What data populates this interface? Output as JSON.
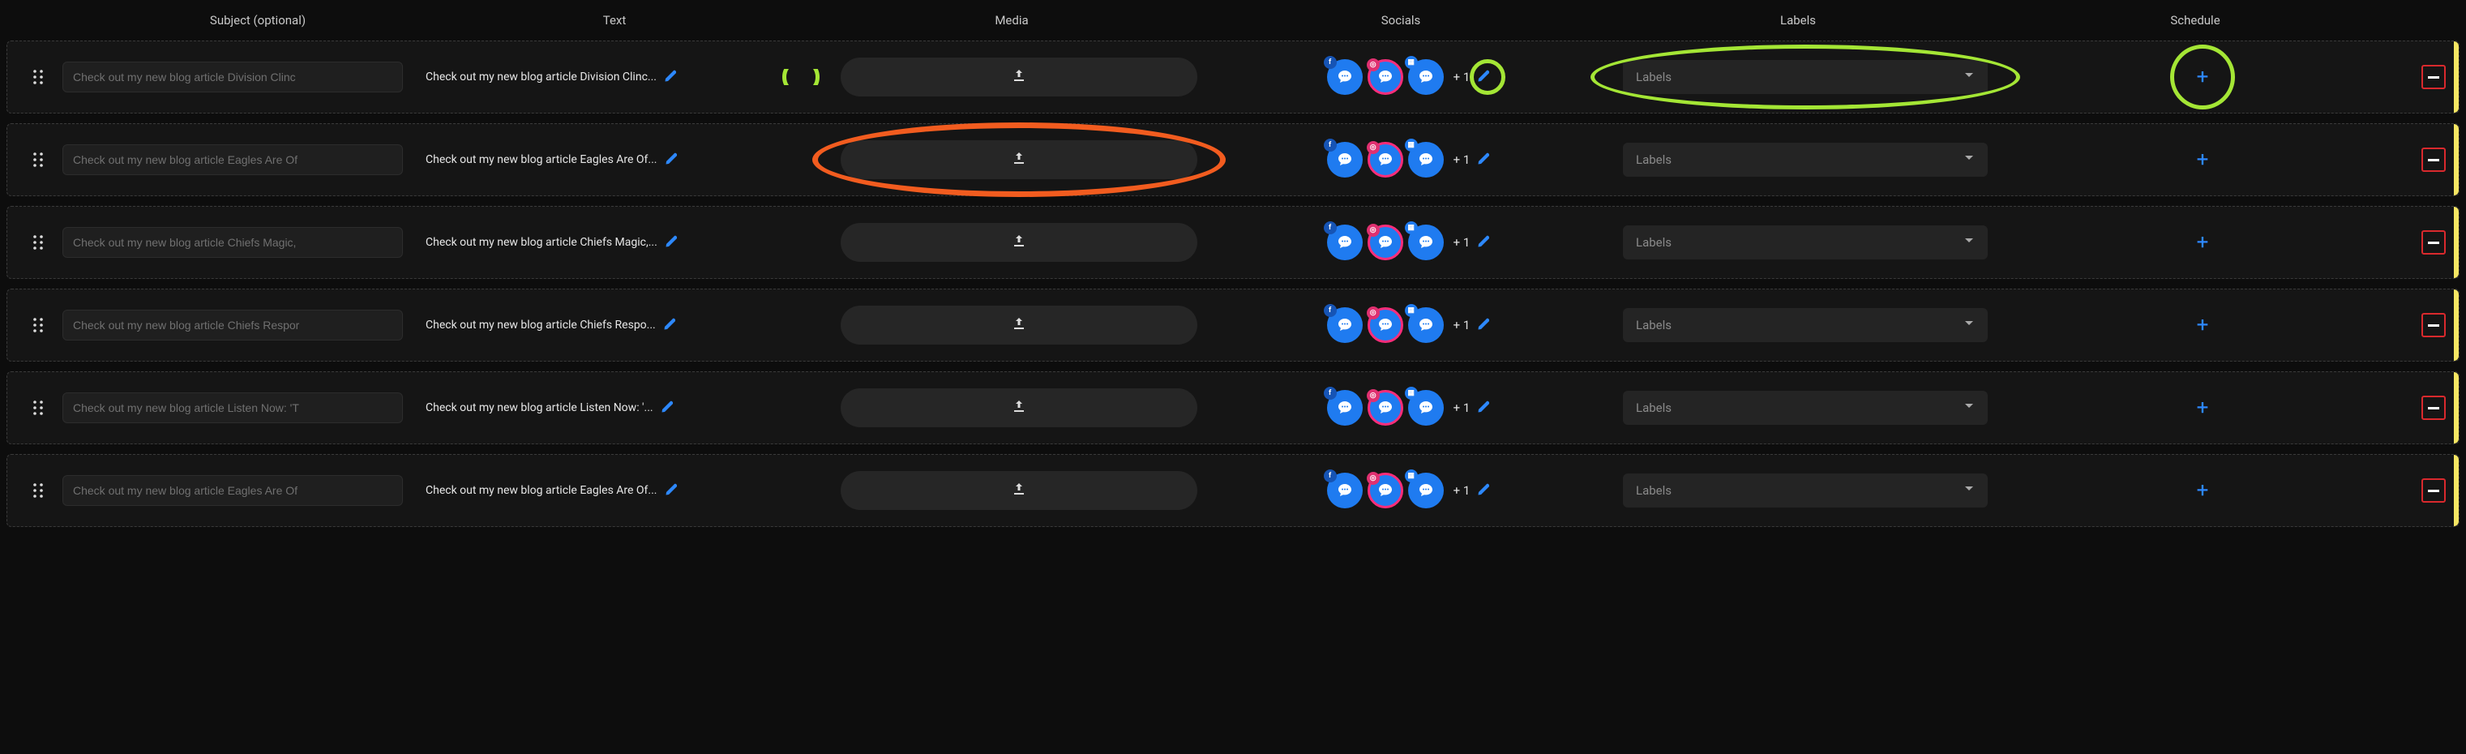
{
  "headers": {
    "subject": "Subject (optional)",
    "text": "Text",
    "media": "Media",
    "socials": "Socials",
    "labels": "Labels",
    "schedule": "Schedule"
  },
  "labels_placeholder": "Labels",
  "more_prefix": "+ ",
  "rows": [
    {
      "subject_placeholder": "Check out my new blog article Division Clinc",
      "text": "Check out my new blog article Division Clinc...",
      "more": "1"
    },
    {
      "subject_placeholder": "Check out my new blog article Eagles Are Of",
      "text": "Check out my new blog article Eagles Are Of...",
      "more": "1"
    },
    {
      "subject_placeholder": "Check out my new blog article Chiefs Magic,",
      "text": "Check out my new blog article Chiefs Magic,...",
      "more": "1"
    },
    {
      "subject_placeholder": "Check out my new blog article Chiefs Respor",
      "text": "Check out my new blog article Chiefs Respo...",
      "more": "1"
    },
    {
      "subject_placeholder": "Check out my new blog article Listen Now: 'T",
      "text": "Check out my new blog article Listen Now: '...",
      "more": "1"
    },
    {
      "subject_placeholder": "Check out my new blog article Eagles Are Of",
      "text": "Check out my new blog article Eagles Are Of...",
      "more": "1"
    }
  ],
  "annotations": {
    "row0": {
      "edit_ring": true,
      "socials_edit_ring": true,
      "labels_ring": true,
      "schedule_ring": true
    },
    "row1": {
      "media_ring": true
    }
  }
}
